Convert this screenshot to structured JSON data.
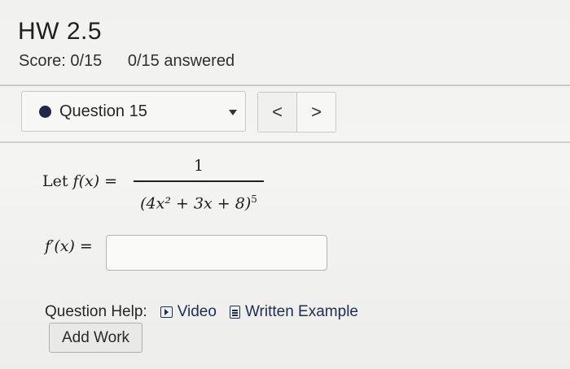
{
  "header": {
    "title": "HW 2.5",
    "score": "Score: 0/15",
    "answered": "0/15 answered"
  },
  "question_nav": {
    "selected": "Question 15",
    "status_color": "#1e2a4a",
    "prev_label": "<",
    "next_label": ">"
  },
  "problem": {
    "intro": "Let",
    "func": "f(x) =",
    "numerator": "1",
    "denominator_base": "(4x² + 3x + 8)",
    "denominator_exponent": "5",
    "derivative_label": "f′(x) =",
    "answer_value": ""
  },
  "help": {
    "label": "Question Help:",
    "video_label": "Video",
    "example_label": "Written Example",
    "add_work_label": "Add Work",
    "video_icon": "play-icon",
    "example_icon": "document-icon"
  }
}
